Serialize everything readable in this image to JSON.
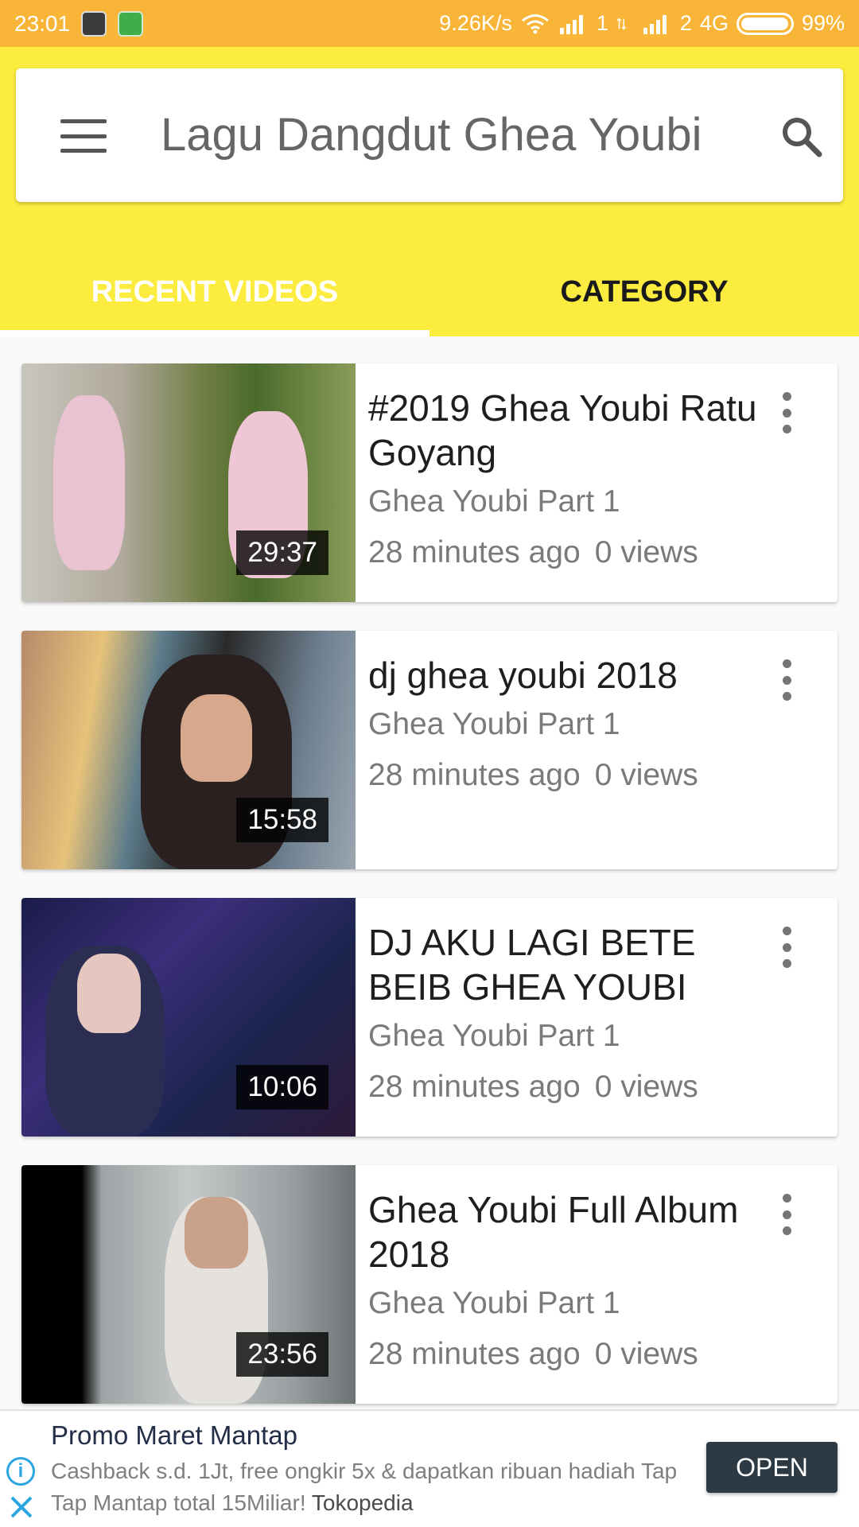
{
  "status_bar": {
    "time": "23:01",
    "network_speed": "9.26K/s",
    "sim1_label": "1",
    "sim2_label": "2",
    "network_type": "4G",
    "battery": "99%",
    "battery_level": 0.99,
    "icons": [
      "bbm-icon",
      "android-icon",
      "wifi-icon",
      "signal-icon",
      "data-transfer-icon",
      "signal-icon",
      "battery-icon"
    ]
  },
  "app_bar": {
    "title": "Lagu Dangdut Ghea Youbi",
    "menu_icon": "hamburger-menu-icon",
    "search_icon": "search-icon",
    "background_color": "#fcec3f"
  },
  "tabs": [
    {
      "label": "RECENT VIDEOS",
      "active": true
    },
    {
      "label": "CATEGORY",
      "active": false
    }
  ],
  "videos": [
    {
      "title": "#2019 Ghea Youbi Ratu Goyang",
      "channel": "Ghea Youbi Part 1",
      "time_ago": "28 minutes ago",
      "views": "0 views",
      "duration": "29:37"
    },
    {
      "title": "dj ghea youbi 2018",
      "channel": "Ghea Youbi Part 1",
      "time_ago": "28 minutes ago",
      "views": "0 views",
      "duration": "15:58"
    },
    {
      "title": "DJ AKU LAGI BETE BEIB GHEA YOUBI",
      "channel": "Ghea Youbi Part 1",
      "time_ago": "28 minutes ago",
      "views": "0 views",
      "duration": "10:06"
    },
    {
      "title": "Ghea Youbi Full Album 2018",
      "channel": "Ghea Youbi Part 1",
      "time_ago": "28 minutes ago",
      "views": "0 views",
      "duration": "23:56"
    }
  ],
  "ad": {
    "title": "Promo Maret Mantap",
    "body": "Cashback s.d. 1Jt, free ongkir 5x & dapatkan ribuan hadiah Tap Tap Mantap total 15Miliar!",
    "brand": "Tokopedia",
    "button_label": "OPEN",
    "button_color": "#2d3a44"
  }
}
